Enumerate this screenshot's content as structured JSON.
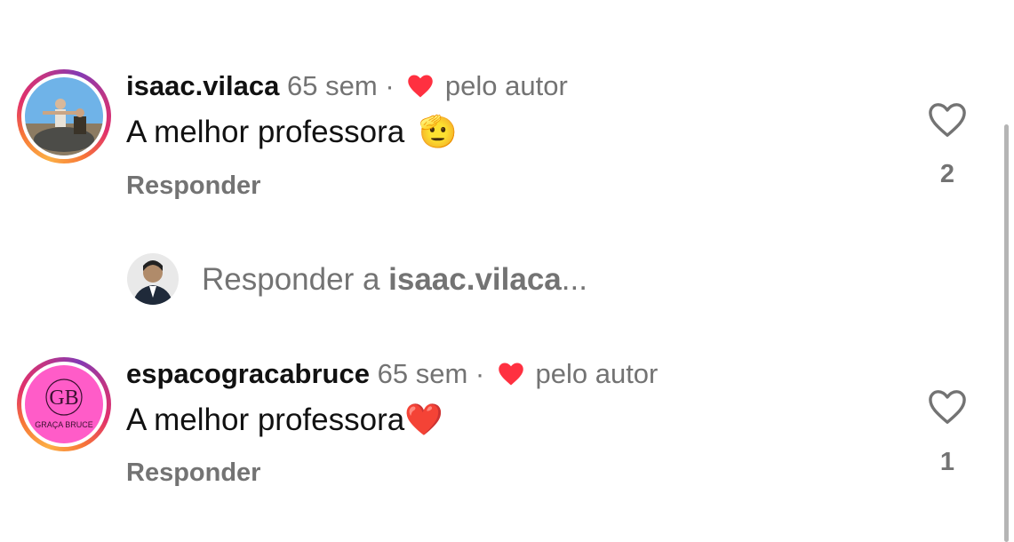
{
  "comments": [
    {
      "username": "isaac.vilaca",
      "time": "65 sem",
      "separator": "·",
      "liked_by_author": "pelo autor",
      "text": "A melhor professora",
      "emoji": "🫡",
      "reply_label": "Responder",
      "like_count": "2",
      "avatar_icon": "avatar-photo"
    },
    {
      "username": "espacogracabruce",
      "time": "65 sem",
      "separator": "·",
      "liked_by_author": "pelo autor",
      "text": "A melhor professora",
      "emoji": "❤️",
      "reply_label": "Responder",
      "like_count": "1",
      "avatar_logo_text": "GRAÇA BRUCE",
      "avatar_logo_monogram": "GB",
      "avatar_icon": "avatar-logo"
    }
  ],
  "reply_box": {
    "prefix": "Responder a",
    "target": "isaac.vilaca",
    "suffix": "..."
  },
  "colors": {
    "heart_red": "#ff3040",
    "muted": "#737373",
    "logo_pink": "#ff5cc8"
  }
}
